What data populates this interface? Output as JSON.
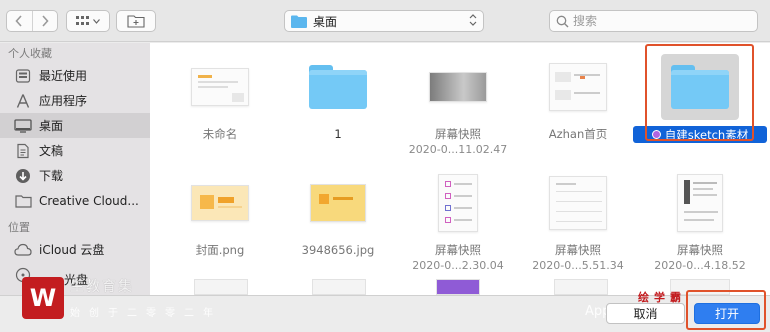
{
  "toolbar": {
    "back_icon": "chevron-left-icon",
    "forward_icon": "chevron-right-icon",
    "view_icon": "grid-view-icon",
    "new_folder_icon": "new-folder-icon",
    "location": "桌面",
    "search_placeholder": "搜索"
  },
  "sidebar": {
    "favorites_title": "个人收藏",
    "favorites": [
      {
        "label": "最近使用",
        "icon": "recents-icon"
      },
      {
        "label": "应用程序",
        "icon": "applications-icon"
      },
      {
        "label": "桌面",
        "icon": "desktop-icon",
        "selected": true
      },
      {
        "label": "文稿",
        "icon": "documents-icon"
      },
      {
        "label": "下载",
        "icon": "downloads-icon"
      },
      {
        "label": "Creative Cloud...",
        "icon": "folder-icon"
      }
    ],
    "locations_title": "位置",
    "locations": [
      {
        "label": "iCloud 云盘",
        "icon": "cloud-icon"
      },
      {
        "label": "光盘",
        "icon": "disc-icon"
      }
    ]
  },
  "files": [
    {
      "name": "未命名",
      "kind": "doc"
    },
    {
      "name": "1",
      "kind": "folder"
    },
    {
      "name": "屏幕快照",
      "sub": "2020-0...11.02.47",
      "kind": "screenshot"
    },
    {
      "name": "Azhan首页",
      "kind": "doc"
    },
    {
      "name": "自建sketch素材",
      "kind": "folder",
      "selected": true
    },
    {
      "name": "封面.png",
      "kind": "image"
    },
    {
      "name": "3948656.jpg",
      "kind": "image"
    },
    {
      "name": "屏幕快照",
      "sub": "2020-0...2.30.04",
      "kind": "screenshot"
    },
    {
      "name": "屏幕快照",
      "sub": "2020-0...5.51.34",
      "kind": "screenshot"
    },
    {
      "name": "屏幕快照",
      "sub": "2020-0...4.18.52",
      "kind": "screenshot"
    }
  ],
  "footer": {
    "cancel_label": "取消",
    "open_label": "打开"
  },
  "watermark": {
    "title": "生教育集",
    "caption": "光盘",
    "slogan": "始创于二零零二年",
    "app_text": "App",
    "brand": "绘学霸",
    "logo_letter": "W"
  },
  "colors": {
    "selection": "#1163d8",
    "folder": "#74c9f6",
    "highlight_box": "#e0522b",
    "open_button": "#2f7ef0"
  }
}
